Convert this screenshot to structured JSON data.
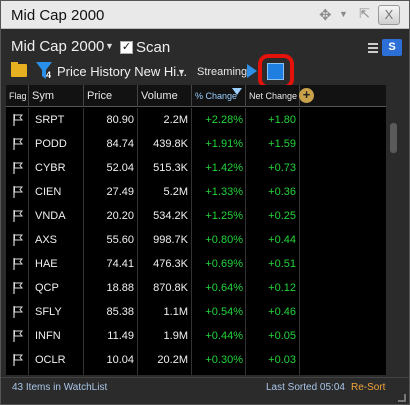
{
  "window": {
    "title": "Mid Cap 2000"
  },
  "header": {
    "list_name": "Mid Cap 2000",
    "scan_label": "Scan",
    "scan_checked": "✓",
    "settings_letter": "S"
  },
  "toolbar": {
    "filter_badge": "4",
    "filter_label": "Price History New Hi...",
    "streaming_label": "Streaming"
  },
  "table": {
    "columns": [
      "Flag",
      "Sym",
      "Price",
      "Volume",
      "% Change",
      "Net Change"
    ],
    "rows": [
      {
        "sym": "SRPT",
        "price": "80.90",
        "volume": "2.2M",
        "pct": "+2.28%",
        "net": "+1.80"
      },
      {
        "sym": "PODD",
        "price": "84.74",
        "volume": "439.8K",
        "pct": "+1.91%",
        "net": "+1.59"
      },
      {
        "sym": "CYBR",
        "price": "52.04",
        "volume": "515.3K",
        "pct": "+1.42%",
        "net": "+0.73"
      },
      {
        "sym": "CIEN",
        "price": "27.49",
        "volume": "5.2M",
        "pct": "+1.33%",
        "net": "+0.36"
      },
      {
        "sym": "VNDA",
        "price": "20.20",
        "volume": "534.2K",
        "pct": "+1.25%",
        "net": "+0.25"
      },
      {
        "sym": "AXS",
        "price": "55.60",
        "volume": "998.7K",
        "pct": "+0.80%",
        "net": "+0.44"
      },
      {
        "sym": "HAE",
        "price": "74.41",
        "volume": "476.3K",
        "pct": "+0.69%",
        "net": "+0.51"
      },
      {
        "sym": "QCP",
        "price": "18.88",
        "volume": "870.8K",
        "pct": "+0.64%",
        "net": "+0.12"
      },
      {
        "sym": "SFLY",
        "price": "85.38",
        "volume": "1.1M",
        "pct": "+0.54%",
        "net": "+0.46"
      },
      {
        "sym": "INFN",
        "price": "11.49",
        "volume": "1.9M",
        "pct": "+0.44%",
        "net": "+0.05"
      },
      {
        "sym": "OCLR",
        "price": "10.04",
        "volume": "20.2M",
        "pct": "+0.30%",
        "net": "+0.03"
      },
      {
        "sym": "HALO",
        "price": "20.24",
        "volume": "1.7M",
        "pct": "+0.29%",
        "net": "+0.06"
      }
    ]
  },
  "footer": {
    "count": "43 Items in WatchList",
    "last_sorted": "Last Sorted 05:04",
    "resort": "Re-Sort"
  },
  "colors": {
    "positive": "#22d43a",
    "annotation": "#e4120b",
    "accent": "#1e7fe0"
  },
  "icons": [
    "move-icon",
    "popout-icon",
    "close-icon",
    "menu-icon",
    "settings-s-icon",
    "folder-icon",
    "filter-icon",
    "play-icon",
    "stop-icon",
    "flag-icon",
    "add-column-icon",
    "annotation-arrow"
  ]
}
